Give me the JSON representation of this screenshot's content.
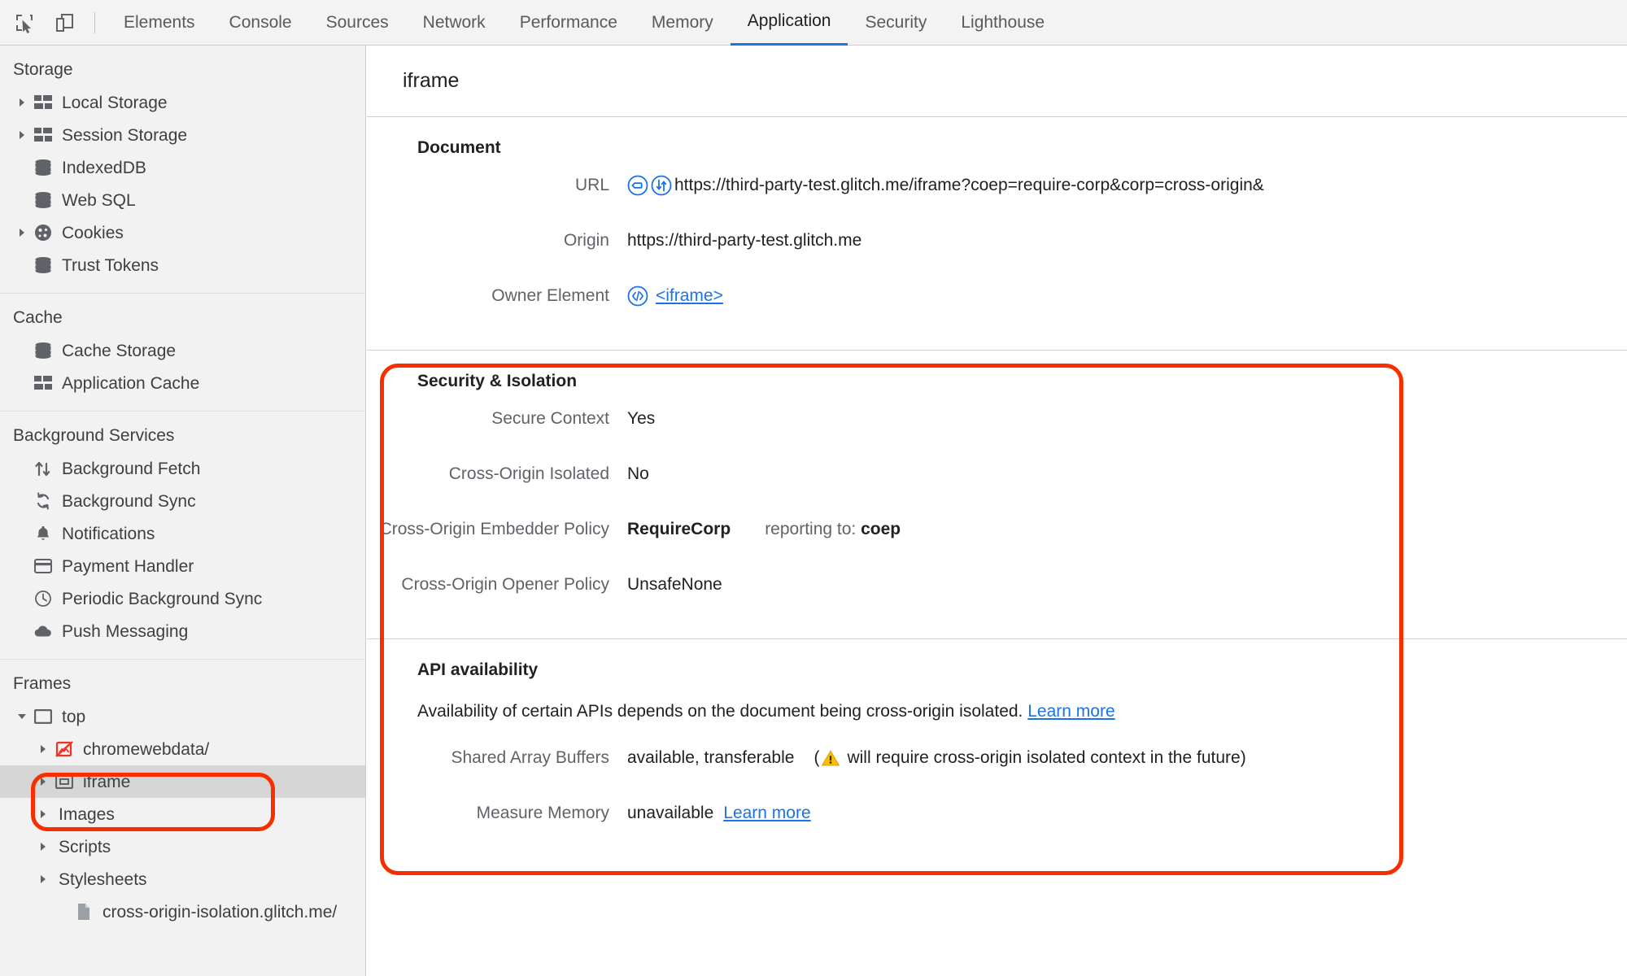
{
  "toolbar": {
    "icons": [
      {
        "name": "inspect-element-icon",
        "label": "Inspect element"
      },
      {
        "name": "device-toolbar-icon",
        "label": "Toggle device toolbar"
      }
    ],
    "tabs": [
      {
        "label": "Elements",
        "active": false
      },
      {
        "label": "Console",
        "active": false
      },
      {
        "label": "Sources",
        "active": false
      },
      {
        "label": "Network",
        "active": false
      },
      {
        "label": "Performance",
        "active": false
      },
      {
        "label": "Memory",
        "active": false
      },
      {
        "label": "Application",
        "active": true
      },
      {
        "label": "Security",
        "active": false
      },
      {
        "label": "Lighthouse",
        "active": false
      }
    ],
    "active_tab": "Application",
    "accent_color": "#1a73e8"
  },
  "sidebar": {
    "sections": [
      {
        "title": "Storage",
        "items": [
          {
            "label": "Local Storage",
            "icon": "table-icon",
            "twisty": "collapsed",
            "indent": 0
          },
          {
            "label": "Session Storage",
            "icon": "table-icon",
            "twisty": "collapsed",
            "indent": 0
          },
          {
            "label": "IndexedDB",
            "icon": "database-icon",
            "twisty": "none",
            "indent": 0
          },
          {
            "label": "Web SQL",
            "icon": "database-icon",
            "twisty": "none",
            "indent": 0
          },
          {
            "label": "Cookies",
            "icon": "cookie-icon",
            "twisty": "collapsed",
            "indent": 0
          },
          {
            "label": "Trust Tokens",
            "icon": "database-icon",
            "twisty": "none",
            "indent": 0
          }
        ]
      },
      {
        "title": "Cache",
        "items": [
          {
            "label": "Cache Storage",
            "icon": "database-icon",
            "twisty": "none",
            "indent": 0
          },
          {
            "label": "Application Cache",
            "icon": "table-icon",
            "twisty": "none",
            "indent": 0
          }
        ]
      },
      {
        "title": "Background Services",
        "items": [
          {
            "label": "Background Fetch",
            "icon": "arrows-updown-icon",
            "twisty": "none",
            "indent": 0
          },
          {
            "label": "Background Sync",
            "icon": "sync-icon",
            "twisty": "none",
            "indent": 0
          },
          {
            "label": "Notifications",
            "icon": "bell-icon",
            "twisty": "none",
            "indent": 0
          },
          {
            "label": "Payment Handler",
            "icon": "credit-card-icon",
            "twisty": "none",
            "indent": 0
          },
          {
            "label": "Periodic Background Sync",
            "icon": "clock-icon",
            "twisty": "none",
            "indent": 0
          },
          {
            "label": "Push Messaging",
            "icon": "cloud-icon",
            "twisty": "none",
            "indent": 0
          }
        ]
      },
      {
        "title": "Frames",
        "items": [
          {
            "label": "top",
            "icon": "frame-icon",
            "twisty": "expanded",
            "indent": 0,
            "selected": false
          },
          {
            "label": "chromewebdata/",
            "icon": "broken-image-icon",
            "twisty": "collapsed",
            "indent": 1,
            "selected": false
          },
          {
            "label": "iframe",
            "icon": "iframe-icon",
            "twisty": "collapsed",
            "indent": 1,
            "selected": true
          },
          {
            "label": "Images",
            "icon": "none",
            "twisty": "collapsed",
            "indent": 1,
            "selected": false
          },
          {
            "label": "Scripts",
            "icon": "none",
            "twisty": "collapsed",
            "indent": 1,
            "selected": false
          },
          {
            "label": "Stylesheets",
            "icon": "none",
            "twisty": "collapsed",
            "indent": 1,
            "selected": false
          },
          {
            "label": "cross-origin-isolation.glitch.me/",
            "icon": "file-icon",
            "twisty": "none",
            "indent": 2,
            "selected": false
          }
        ]
      }
    ]
  },
  "panel": {
    "title": "iframe",
    "document": {
      "heading": "Document",
      "rows": [
        {
          "name": "URL",
          "value": "https://third-party-test.glitch.me/iframe?coep=require-corp&corp=cross-origin&",
          "icons": [
            "tag-circle-icon",
            "network-circle-icon"
          ]
        },
        {
          "name": "Origin",
          "value": "https://third-party-test.glitch.me",
          "icons": []
        },
        {
          "name": "Owner Element",
          "value": "<iframe>",
          "icons": [
            "code-circle-icon"
          ],
          "link": true
        }
      ]
    },
    "security": {
      "heading": "Security & Isolation",
      "rows": [
        {
          "name": "Secure Context",
          "value": "Yes",
          "extra": ""
        },
        {
          "name": "Cross-Origin Isolated",
          "value": "No",
          "extra": ""
        },
        {
          "name": "Cross-Origin Embedder Policy",
          "value": "RequireCorp",
          "extra_label": "reporting to:",
          "extra_value": "coep"
        },
        {
          "name": "Cross-Origin Opener Policy",
          "value": "UnsafeNone",
          "extra": ""
        }
      ]
    },
    "api": {
      "heading": "API availability",
      "description": "Availability of certain APIs depends on the document being cross-origin isolated.",
      "description_link": "Learn more",
      "rows": [
        {
          "name": "Shared Array Buffers",
          "value": "available, transferable",
          "note_open": "(",
          "note_icon": "warning-triangle-icon",
          "note_text": "will require cross-origin isolated context in the future)"
        },
        {
          "name": "Measure Memory",
          "value": "unavailable",
          "link": "Learn more"
        }
      ]
    }
  },
  "annotations": {
    "color": "#f72f00",
    "boxes": [
      {
        "name": "frames-highlight",
        "target": "chromewebdata-and-iframe-rows"
      },
      {
        "name": "security-api-highlight",
        "target": "security-isolation-and-api-availability"
      }
    ]
  }
}
